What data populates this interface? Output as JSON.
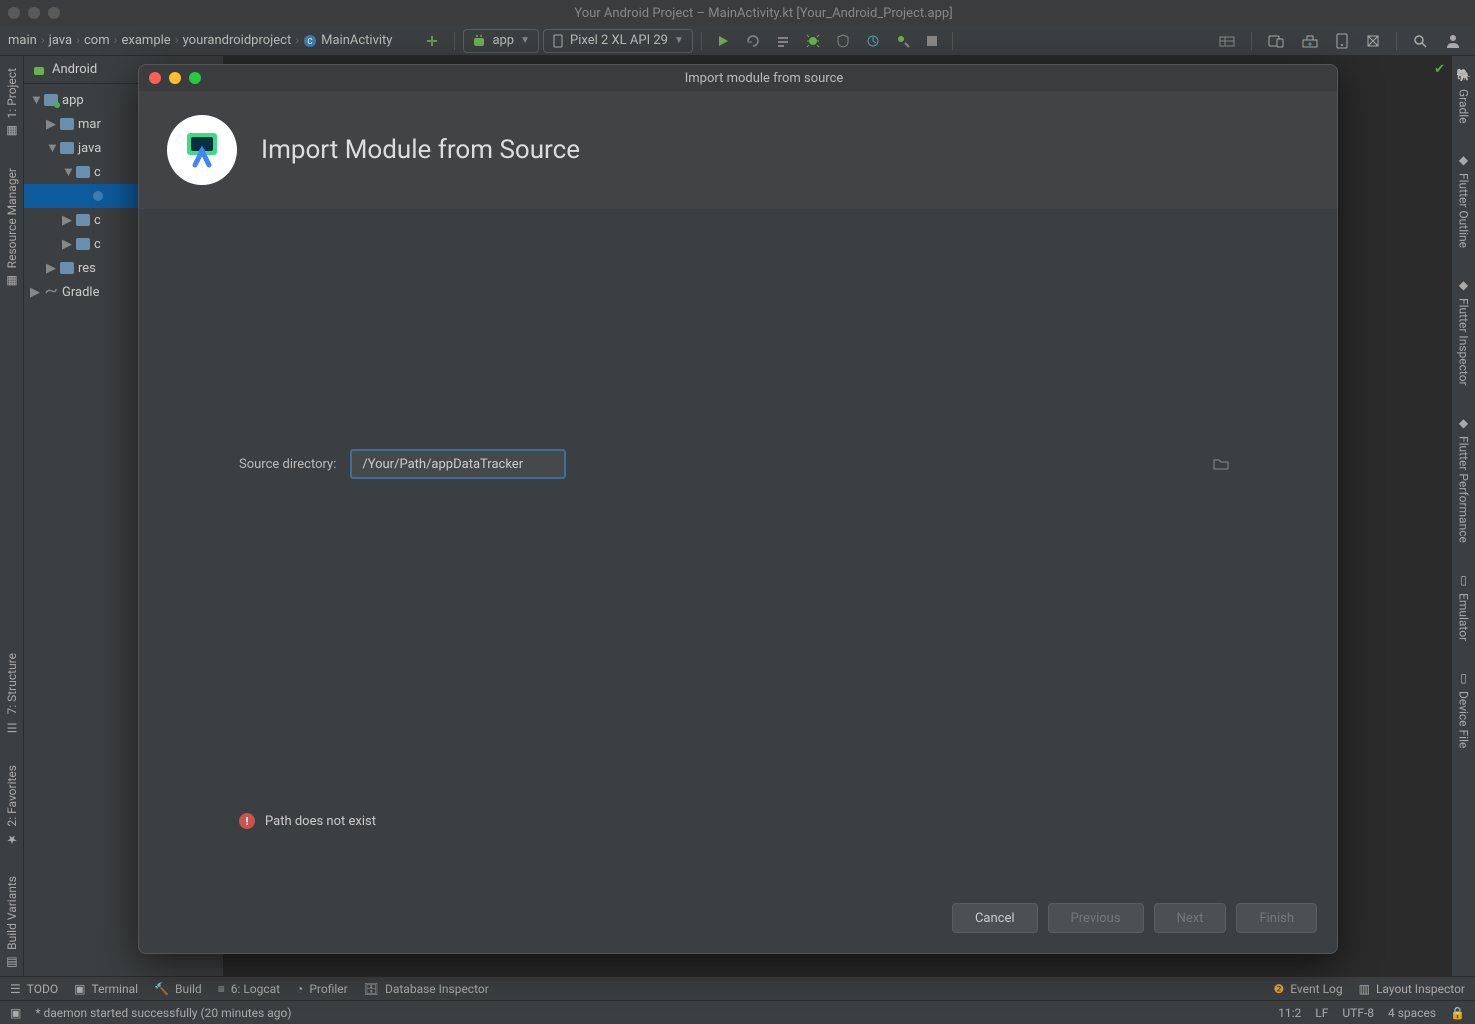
{
  "window": {
    "title": "Your Android Project – MainActivity.kt [Your_Android_Project.app]"
  },
  "breadcrumbs": [
    "main",
    "java",
    "com",
    "example",
    "yourandroidproject",
    "MainActivity"
  ],
  "runConfig": {
    "module": "app",
    "device": "Pixel 2 XL API 29"
  },
  "leftGutter": {
    "project": "1: Project",
    "resource": "Resource Manager",
    "structure": "7: Structure",
    "favorites": "2: Favorites",
    "variants": "Build Variants"
  },
  "rightGutter": {
    "gradle": "Gradle",
    "flutterOutline": "Flutter Outline",
    "flutterInspector": "Flutter Inspector",
    "flutterPerf": "Flutter Performance",
    "emulator": "Emulator",
    "deviceFile": "Device File"
  },
  "sidebar": {
    "header": "Android",
    "tree": {
      "app": "app",
      "man": "mar",
      "java": "java",
      "c1": "c",
      "c2": "c",
      "c3": "c",
      "res": "res",
      "gradle": "Gradle"
    }
  },
  "bottom": {
    "todo": "TODO",
    "terminal": "Terminal",
    "build": "Build",
    "logcat": "6: Logcat",
    "profiler": "Profiler",
    "db": "Database Inspector",
    "eventlog": "Event Log",
    "layoutinsp": "Layout Inspector"
  },
  "status": {
    "msg": "* daemon started successfully (20 minutes ago)",
    "pos": "11:2",
    "lf": "LF",
    "enc": "UTF-8",
    "indent": "4 spaces"
  },
  "dialog": {
    "winTitle": "Import module from source",
    "headline": "Import Module from Source",
    "label": "Source directory:",
    "path": "/Your/Path/appDataTracker",
    "error": "Path does not exist",
    "buttons": {
      "cancel": "Cancel",
      "prev": "Previous",
      "next": "Next",
      "finish": "Finish"
    }
  }
}
